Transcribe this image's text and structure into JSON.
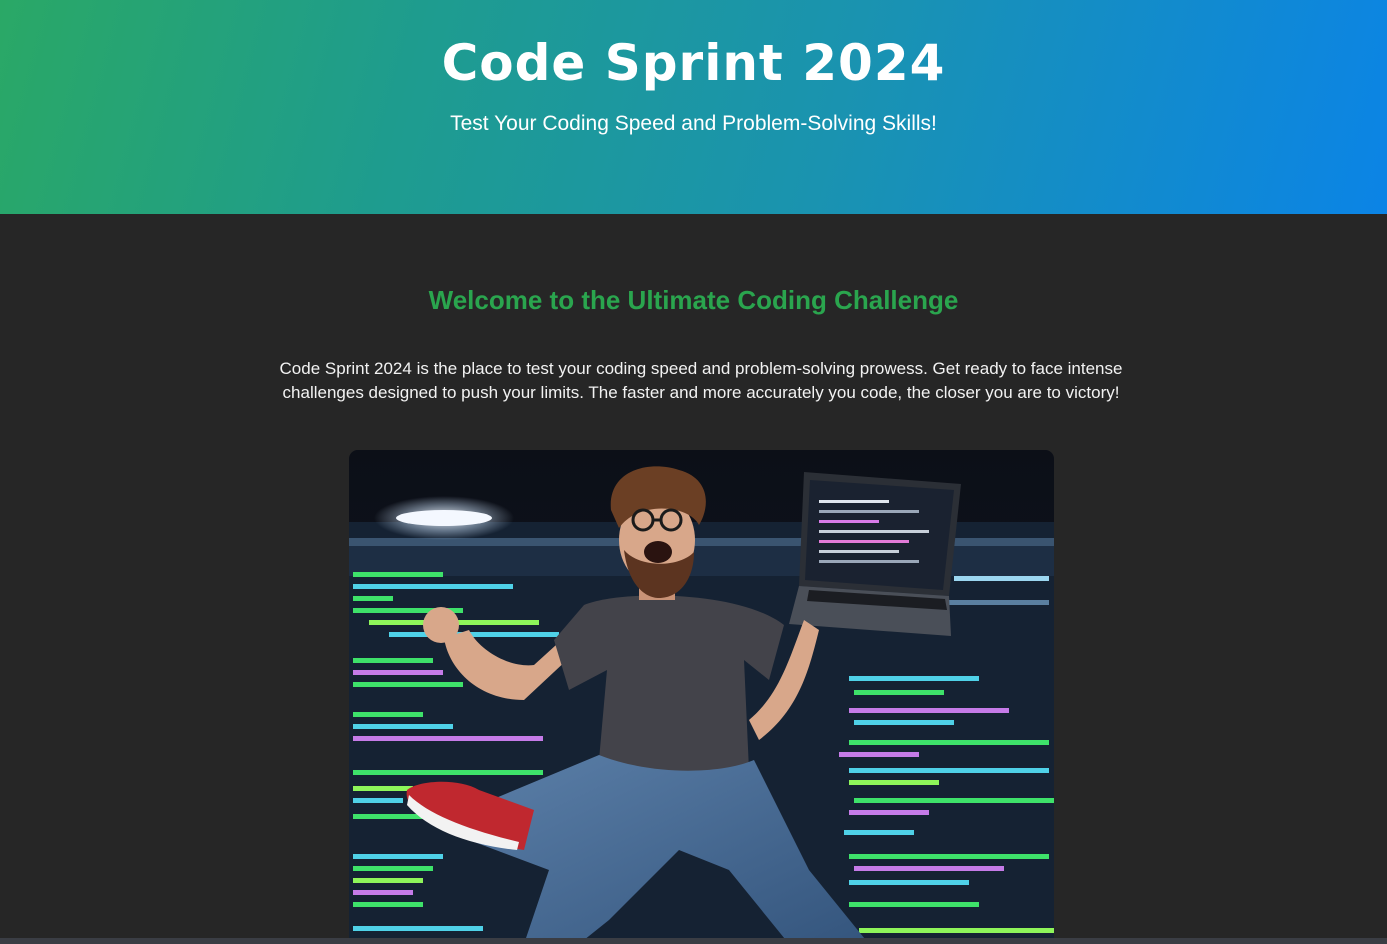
{
  "header": {
    "title": "Code Sprint 2024",
    "subtitle": "Test Your Coding Speed and Problem-Solving Skills!"
  },
  "main": {
    "heading": "Welcome to the Ultimate Coding Challenge",
    "intro": "Code Sprint 2024 is the place to test your coding speed and problem-solving prowess. Get ready to face intense challenges designed to push your limits. The faster and more accurately you code, the closer you are to victory!",
    "image_icon": "celebrating-coder-photo"
  },
  "colors": {
    "gradient_start": "#2aa866",
    "gradient_end": "#0b84e6",
    "heading_green": "#2aa54e",
    "page_background": "#262626",
    "text": "#f2f2f2"
  }
}
